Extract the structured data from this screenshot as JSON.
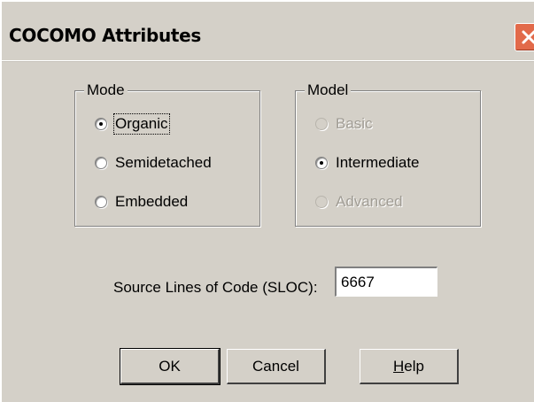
{
  "window": {
    "title": "COCOMO Attributes",
    "close_icon": "close-icon",
    "accent_close": "#e26a4a",
    "background": "#d4d0c8"
  },
  "mode_group": {
    "legend": "Mode",
    "options": [
      {
        "label": "Organic",
        "checked": true,
        "enabled": true
      },
      {
        "label": "Semidetached",
        "checked": false,
        "enabled": true
      },
      {
        "label": "Embedded",
        "checked": false,
        "enabled": true
      }
    ]
  },
  "model_group": {
    "legend": "Model",
    "options": [
      {
        "label": "Basic",
        "checked": false,
        "enabled": false
      },
      {
        "label": "Intermediate",
        "checked": true,
        "enabled": true
      },
      {
        "label": "Advanced",
        "checked": false,
        "enabled": false
      }
    ]
  },
  "sloc": {
    "label": "Source Lines of Code (SLOC):",
    "value": "6667"
  },
  "buttons": {
    "ok": "OK",
    "cancel": "Cancel",
    "help_prefix": "H",
    "help_rest": "elp"
  }
}
